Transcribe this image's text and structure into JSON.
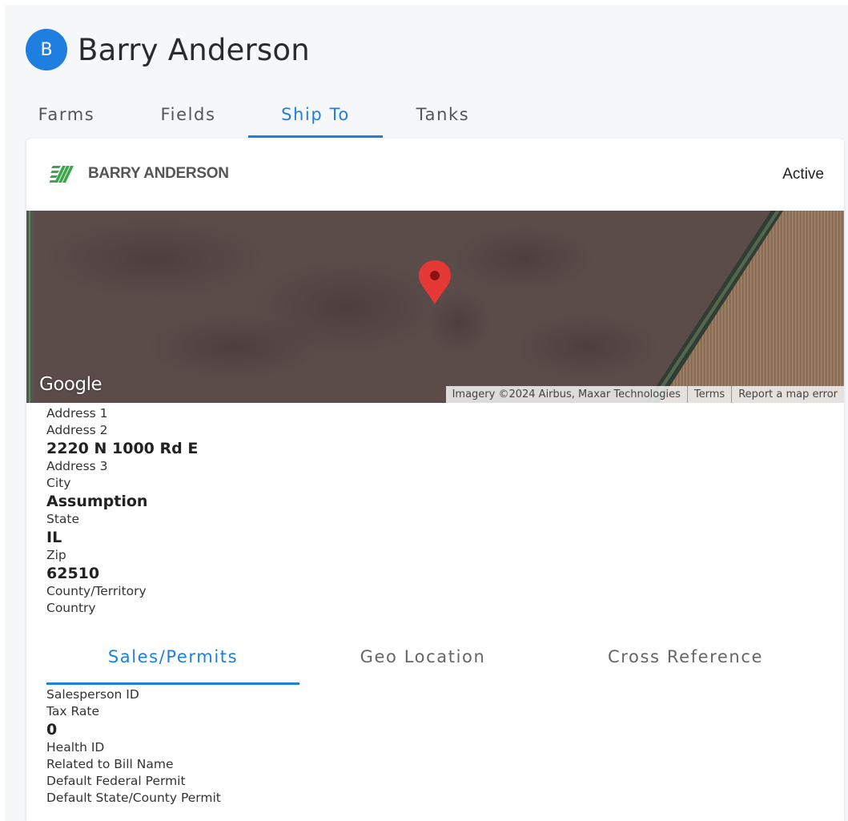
{
  "customer": {
    "avatar_letter": "B",
    "name": "Barry Anderson"
  },
  "top_tabs": [
    {
      "label": "Farms"
    },
    {
      "label": "Fields"
    },
    {
      "label": "Ship To",
      "active": true
    },
    {
      "label": "Tanks"
    }
  ],
  "card": {
    "logo_icon": "striped-slash-logo-icon",
    "title": "BARRY ANDERSON",
    "status": "Active"
  },
  "map": {
    "provider_logo": "Google",
    "attribution": {
      "imagery": "Imagery ©2024 Airbus, Maxar Technologies",
      "terms": "Terms",
      "report": "Report a map error"
    },
    "marker_icon": "map-pin-icon"
  },
  "address": {
    "address1_label": "Address 1",
    "address2_label": "Address 2",
    "address2_value": "2220 N 1000 Rd E",
    "address3_label": "Address 3",
    "city_label": "City",
    "city_value": "Assumption",
    "state_label": "State",
    "state_value": "IL",
    "zip_label": "Zip",
    "zip_value": "62510",
    "county_label": "County/Territory",
    "country_label": "Country"
  },
  "sub_tabs": [
    {
      "label": "Sales/Permits",
      "active": true
    },
    {
      "label": "Geo Location"
    },
    {
      "label": "Cross Reference"
    }
  ],
  "sales": {
    "salesperson_label": "Salesperson ID",
    "tax_rate_label": "Tax Rate",
    "tax_rate_value": "0",
    "health_id_label": "Health ID",
    "related_bill_label": "Related to Bill Name",
    "federal_permit_label": "Default Federal Permit",
    "state_permit_label": "Default State/County Permit"
  },
  "colors": {
    "accent": "#1e7fe0",
    "logo_green": "#3aa84a",
    "marker_red": "#e53935"
  }
}
